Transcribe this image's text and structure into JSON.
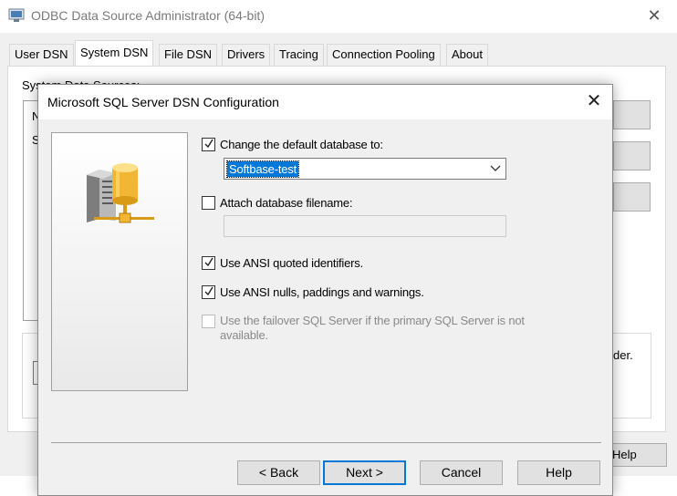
{
  "background_window": {
    "title": "ODBC Data Source Administrator (64-bit)",
    "close_icon": "✕",
    "tabs": [
      {
        "label": "User DSN",
        "active": false
      },
      {
        "label": "System DSN",
        "active": true
      },
      {
        "label": "File DSN",
        "active": false
      },
      {
        "label": "Drivers",
        "active": false
      },
      {
        "label": "Tracing",
        "active": false
      },
      {
        "label": "Connection Pooling",
        "active": false
      },
      {
        "label": "About",
        "active": false
      }
    ],
    "partial_texts": {
      "section_label": "System Data Sources:",
      "list_row1": "N",
      "list_row2": "S",
      "group_text_tail": "der.",
      "help_label": "Help"
    }
  },
  "dialog": {
    "title": "Microsoft SQL Server DSN Configuration",
    "close_icon": "✕",
    "options": {
      "change_default_db": {
        "label": "Change the default database to:",
        "checked": true,
        "enabled": true
      },
      "default_db_value": "Softbase-test",
      "attach_db_filename": {
        "label": "Attach database filename:",
        "checked": false,
        "enabled": true
      },
      "attach_value": "",
      "ansi_quoted": {
        "label": "Use ANSI quoted identifiers.",
        "checked": true,
        "enabled": true
      },
      "ansi_nulls": {
        "label": "Use ANSI nulls, paddings and warnings.",
        "checked": true,
        "enabled": true
      },
      "failover": {
        "label": "Use the failover SQL Server if the primary SQL Server is not available.",
        "checked": false,
        "enabled": false
      }
    },
    "buttons": {
      "back": "< Back",
      "next": "Next >",
      "cancel": "Cancel",
      "help": "Help"
    },
    "icons": {
      "server": "server-database-icon",
      "dropdown": "chevron-down-icon",
      "checkmark": "checkmark-icon"
    }
  },
  "colors": {
    "selection": "#0078d7",
    "dialog_bg": "#f0f0f0",
    "button_bg": "#e1e1e1"
  }
}
